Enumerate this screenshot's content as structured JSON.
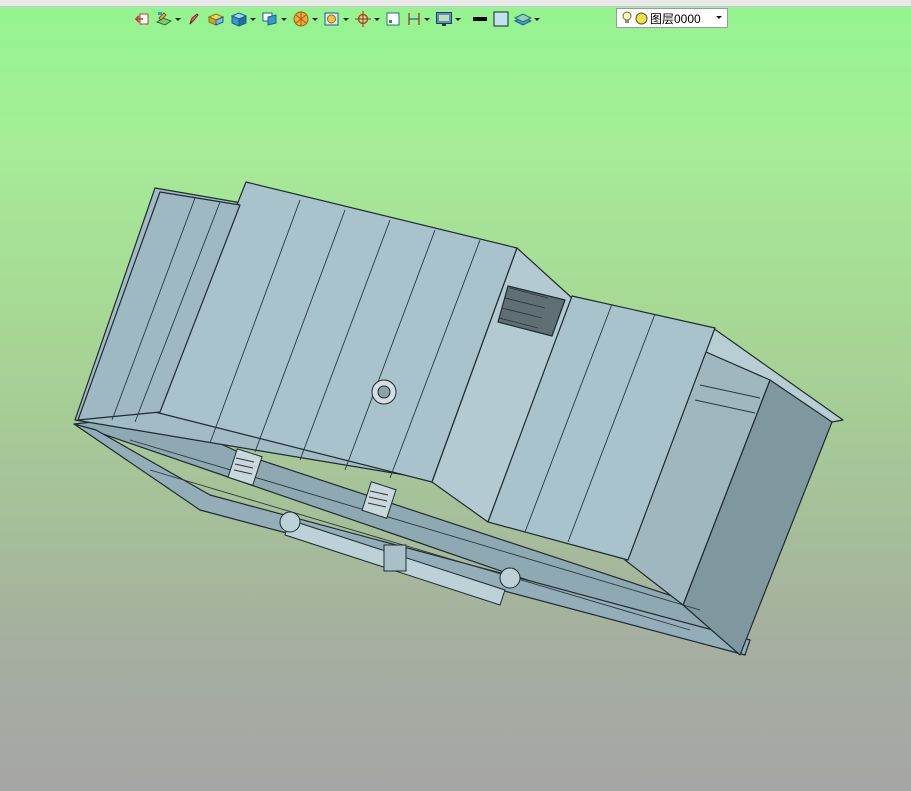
{
  "toolbar": {
    "buttons": [
      {
        "icon": "exit-sketch-icon",
        "dropdown": false
      },
      {
        "icon": "sketch-plane-icon",
        "dropdown": true
      },
      {
        "icon": "pencil-sketch-icon",
        "dropdown": false
      },
      {
        "icon": "extrude-solid-icon",
        "dropdown": false
      },
      {
        "icon": "solid-cube-icon",
        "dropdown": true
      },
      {
        "icon": "view-orientation-icon",
        "dropdown": true
      },
      {
        "icon": "render-style-icon",
        "dropdown": true
      },
      {
        "icon": "section-view-icon",
        "dropdown": true
      },
      {
        "icon": "coordinate-system-icon",
        "dropdown": true
      },
      {
        "icon": "component-window-icon",
        "dropdown": false
      },
      {
        "icon": "dimension-icon",
        "dropdown": true
      },
      {
        "icon": "display-settings-icon",
        "dropdown": true
      },
      {
        "icon": "line-color-icon",
        "dropdown": false
      },
      {
        "icon": "fill-color-icon",
        "dropdown": false
      },
      {
        "icon": "layers-icon",
        "dropdown": true
      }
    ],
    "layer": {
      "name": "图层0000",
      "visibility_icon": "lightbulb-icon",
      "state_icon": "yellow-dot-icon"
    }
  },
  "viewport": {
    "background_top": "#93f58f",
    "background_bottom": "#a6a6a6",
    "model_color": "#a5bec6",
    "edge_color": "#1e2b30"
  }
}
